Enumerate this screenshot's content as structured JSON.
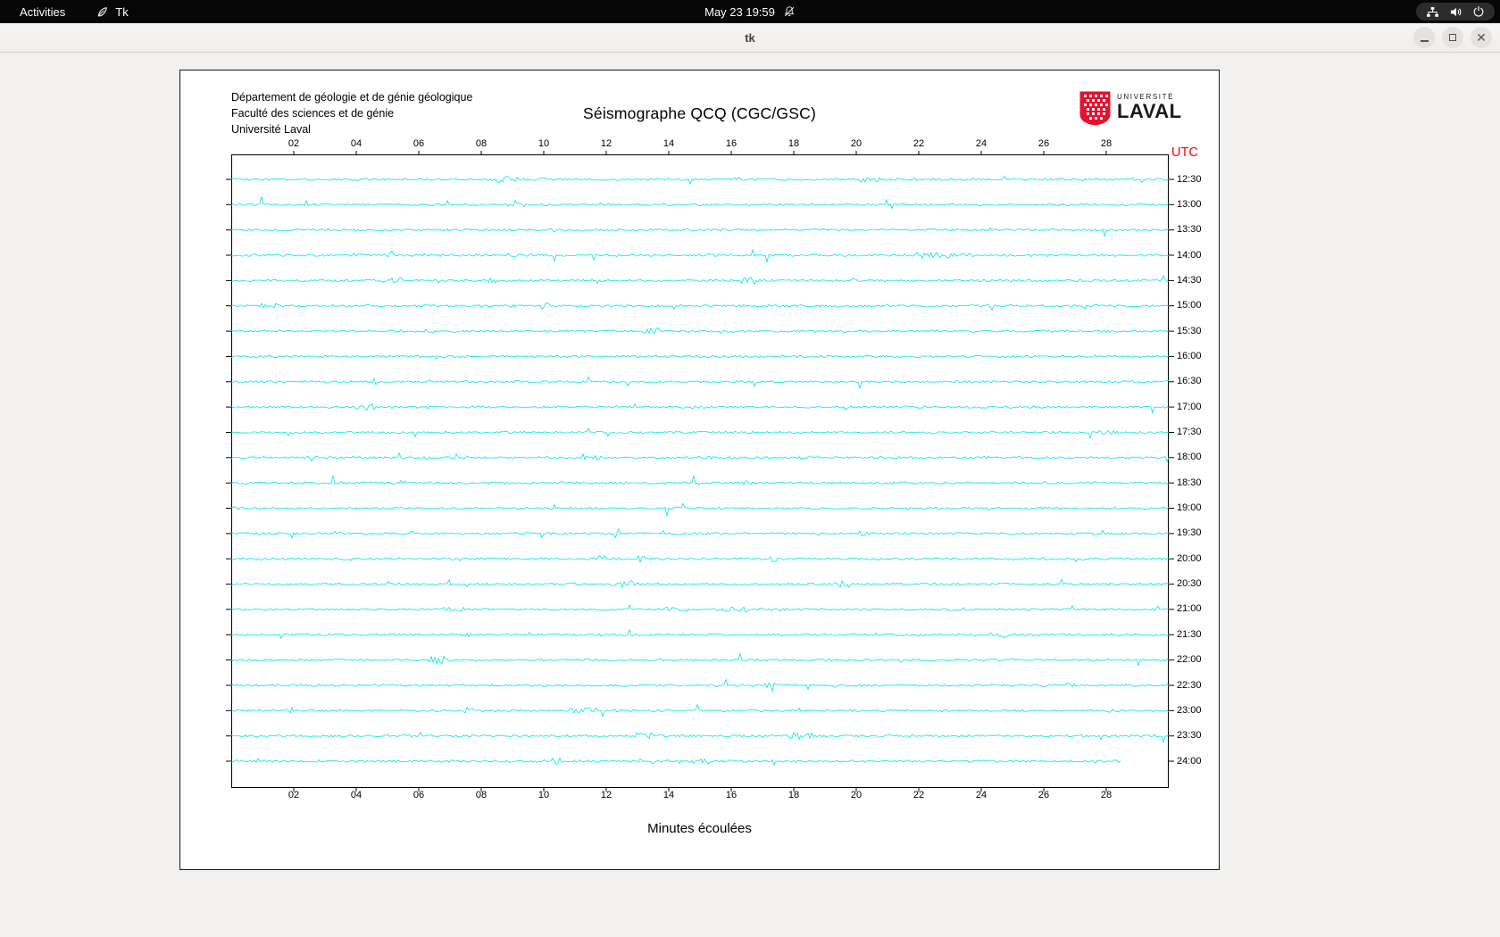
{
  "top_bar": {
    "activities_label": "Activities",
    "app_name": "Tk",
    "clock": "May 23 19:59"
  },
  "window": {
    "title": "tk"
  },
  "seismograph": {
    "header_lines": [
      "Département de géologie et de génie géologique",
      "Faculté des sciences et de génie",
      "Université Laval"
    ],
    "title": "Séismographe QCQ (CGC/GSC)",
    "utc_label": "UTC",
    "x_axis_label": "Minutes écoulées",
    "logo": {
      "top_text": "UNIVERSITÉ",
      "bottom_text": "LAVAL"
    },
    "x_ticks": [
      "02",
      "04",
      "06",
      "08",
      "10",
      "12",
      "14",
      "16",
      "18",
      "20",
      "22",
      "24",
      "26",
      "28"
    ],
    "time_labels": [
      "12:30",
      "13:00",
      "13:30",
      "14:00",
      "14:30",
      "15:00",
      "15:30",
      "16:00",
      "16:30",
      "17:00",
      "17:30",
      "18:00",
      "18:30",
      "19:00",
      "19:30",
      "20:00",
      "20:30",
      "21:00",
      "21:30",
      "22:00",
      "22:30",
      "23:00",
      "23:30",
      "24:00"
    ],
    "trace_color": "#00e6e6",
    "utc_color": "#ff0000"
  },
  "chart_data": {
    "type": "line",
    "title": "Séismographe QCQ (CGC/GSC)",
    "xlabel": "Minutes écoulées",
    "x_range_minutes": [
      0,
      30
    ],
    "x_ticks": [
      2,
      4,
      6,
      8,
      10,
      12,
      14,
      16,
      18,
      20,
      22,
      24,
      26,
      28
    ],
    "rows_utc": [
      "12:30",
      "13:00",
      "13:30",
      "14:00",
      "14:30",
      "15:00",
      "15:30",
      "16:00",
      "16:30",
      "17:00",
      "17:30",
      "18:00",
      "18:30",
      "19:00",
      "19:30",
      "20:00",
      "20:30",
      "21:00",
      "21:30",
      "22:00",
      "22:30",
      "23:00",
      "23:30",
      "24:00"
    ],
    "series_style": "24 half-hour seismogram noise traces in cyan; final trace (24:00) ends at ~28.5 minutes"
  }
}
